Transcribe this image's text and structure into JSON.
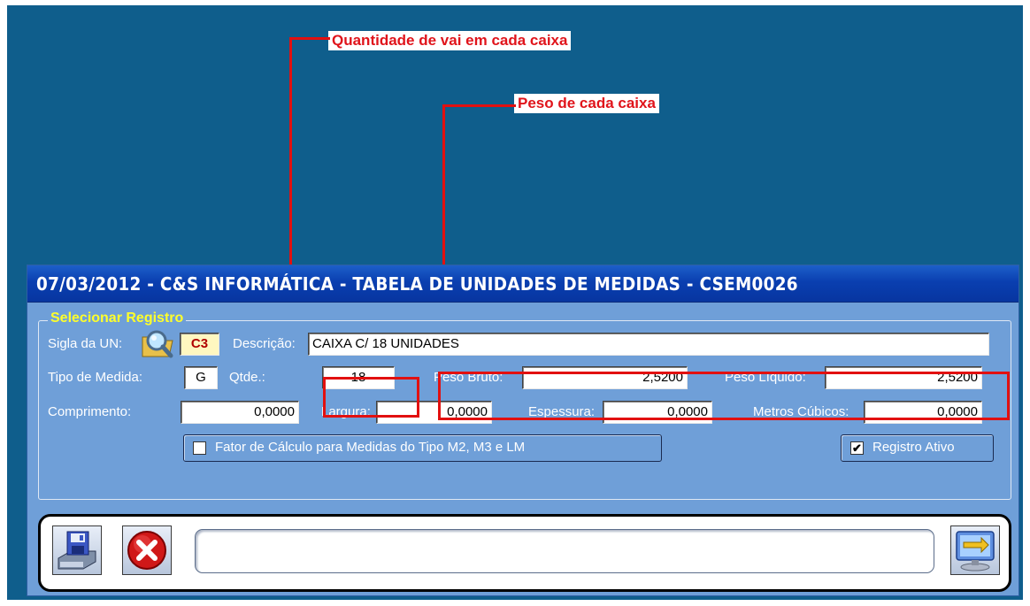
{
  "annotations": {
    "quantity_note": "Quantidade de vai em cada caixa",
    "weight_note": "Peso de cada caixa"
  },
  "window": {
    "title": "07/03/2012  -  C&S INFORMÁTICA  -  TABELA DE UNIDADES DE MEDIDAS  -  CSEM0026"
  },
  "group": {
    "legend": "Selecionar Registro"
  },
  "form": {
    "sigla_label": "Sigla da UN:",
    "sigla_value": "C3",
    "descricao_label": "Descrição:",
    "descricao_value": "CAIXA C/ 18 UNIDADES",
    "tipo_medida_label": "Tipo de Medida:",
    "tipo_medida_value": "G",
    "qtde_label": "Qtde.:",
    "qtde_value": "18",
    "peso_bruto_label": "Peso Bruto:",
    "peso_bruto_value": "2,5200",
    "peso_liquido_label": "Peso Líquido:",
    "peso_liquido_value": "2,5200",
    "comprimento_label": "Comprimento:",
    "comprimento_value": "0,0000",
    "largura_label": "Largura:",
    "largura_value": "0,0000",
    "espessura_label": "Espessura:",
    "espessura_value": "0,0000",
    "metros_cubicos_label": "Metros Cúbicos:",
    "metros_cubicos_value": "0,0000",
    "fator_label": "Fator de Cálculo para Medidas do Tipo M2, M3 e LM",
    "fator_checked": false,
    "registro_ativo_label": "Registro Ativo",
    "registro_ativo_checked": true,
    "check_mark": "✔"
  },
  "toolbar": {
    "status_text": "",
    "icons": [
      "save-icon",
      "cancel-icon",
      "swap-icon"
    ]
  },
  "colors": {
    "desktop": "#0f5e8c",
    "window_body": "#6f9fd8",
    "titlebar": "#0a3fb0",
    "legend_text": "#ffff2a",
    "annotation_red": "#e21010"
  }
}
